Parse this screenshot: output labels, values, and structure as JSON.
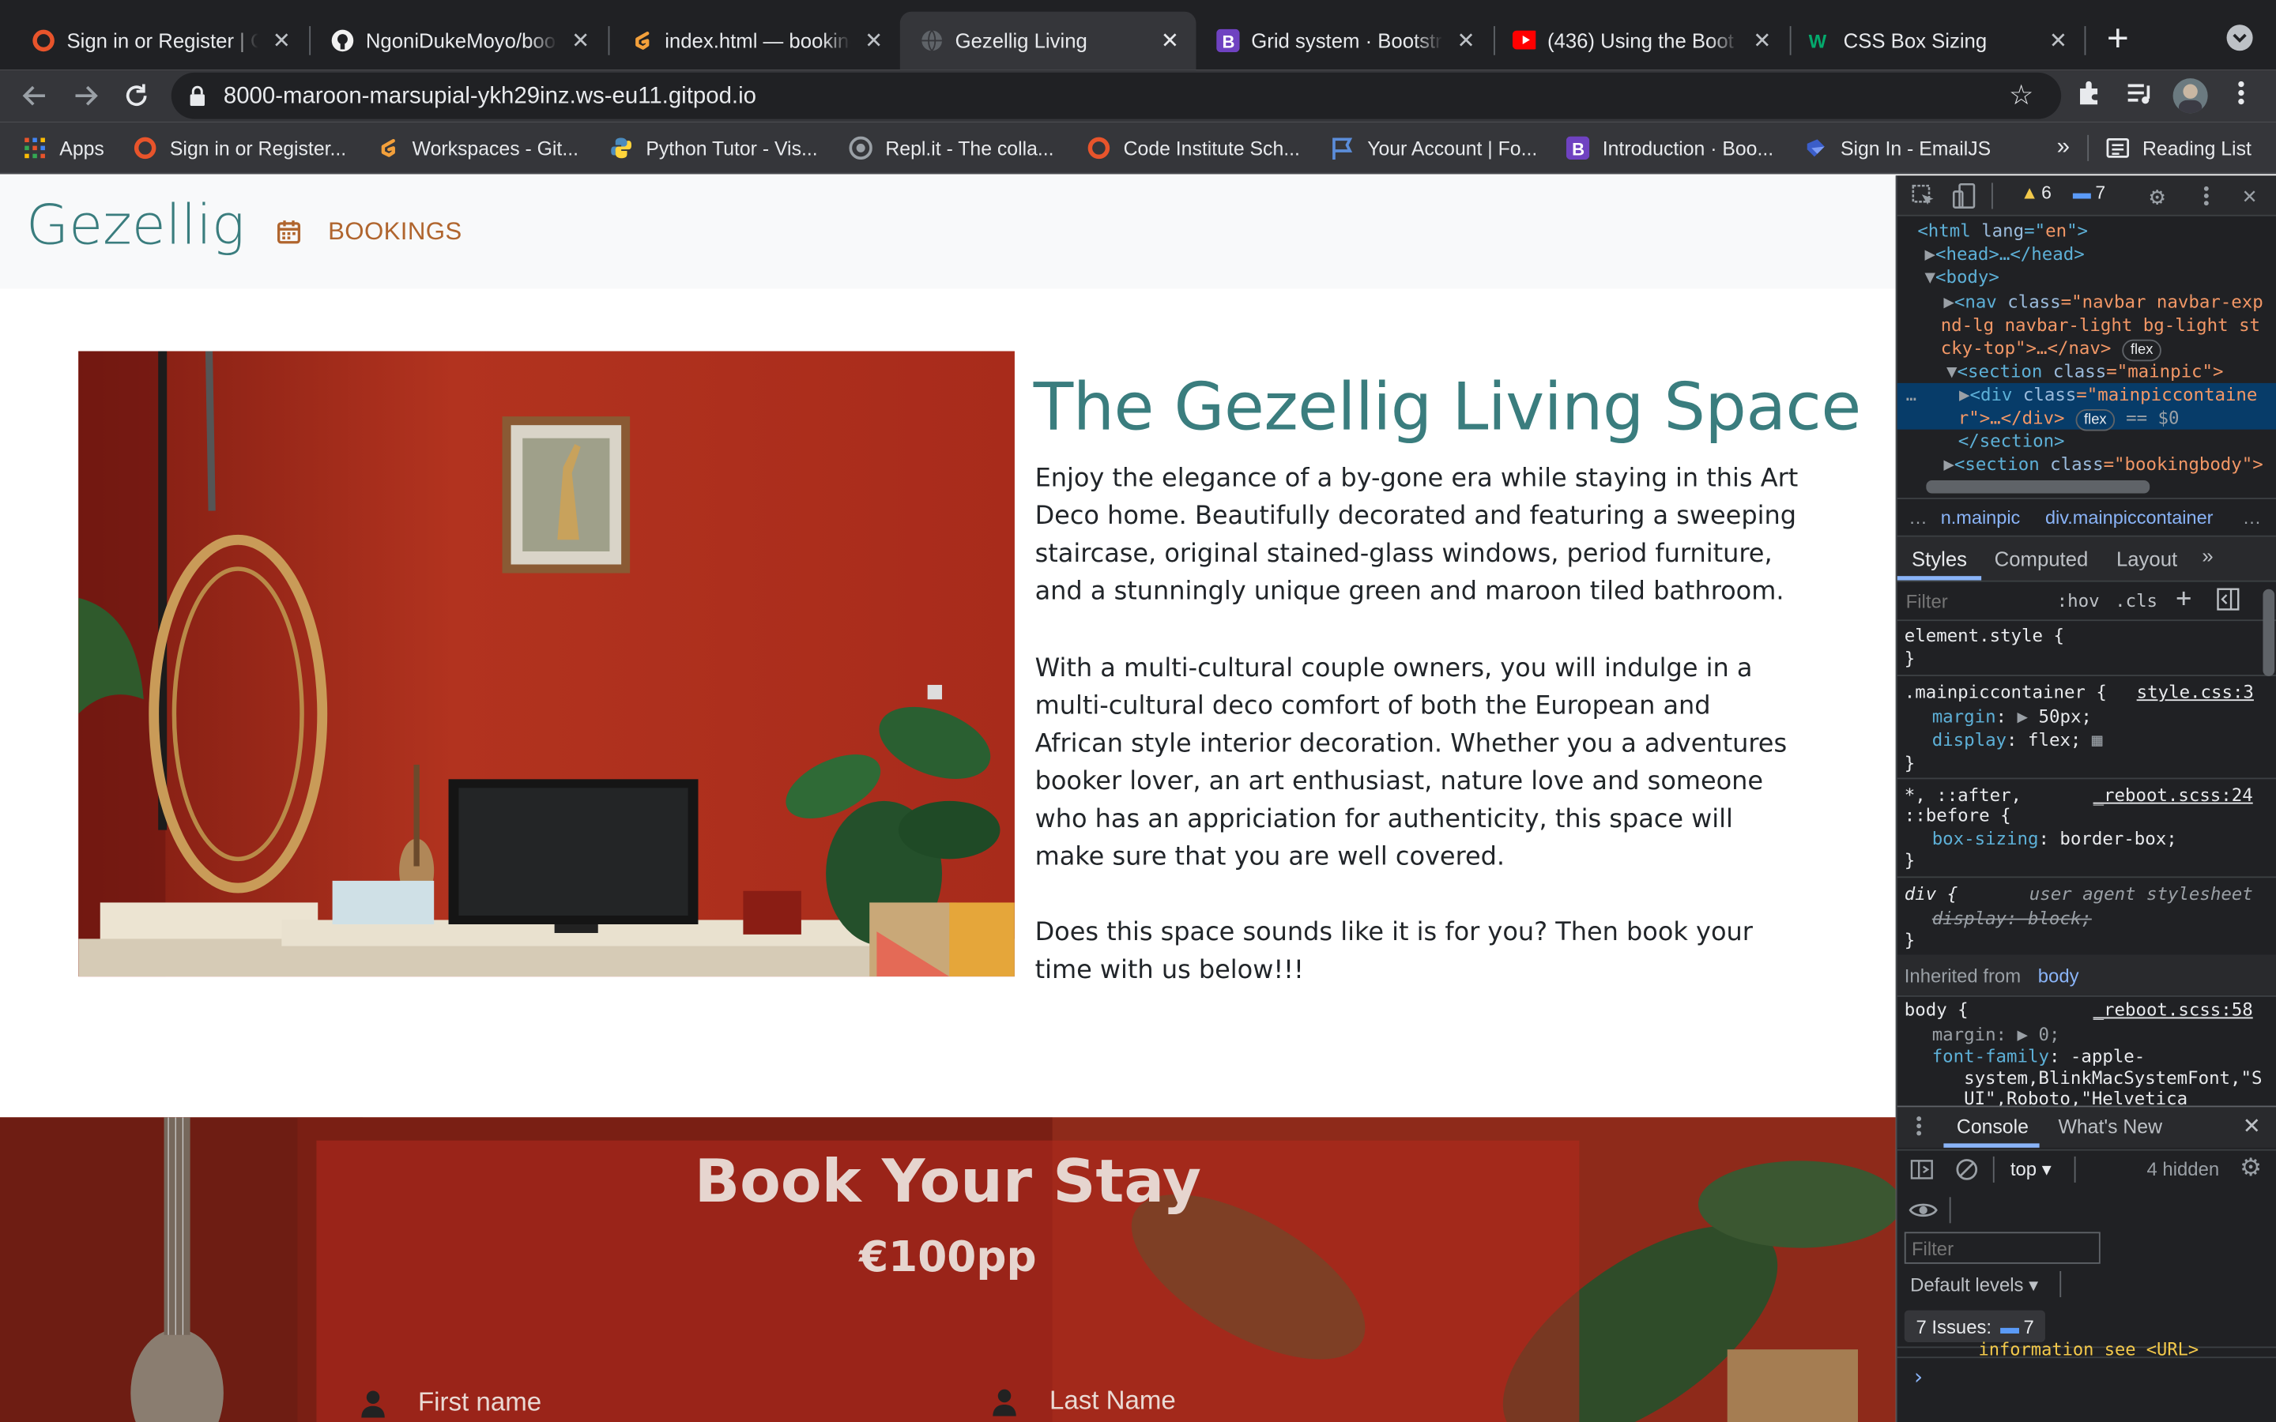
{
  "browser": {
    "tabs": [
      {
        "title": "Sign in or Register | C",
        "icon": "circle-orange-icon",
        "active": false
      },
      {
        "title": "NgoniDukeMoyo/book",
        "icon": "github-icon",
        "active": false
      },
      {
        "title": "index.html — booking",
        "icon": "gitpod-icon",
        "active": false
      },
      {
        "title": "Gezellig Living",
        "icon": "globe-icon",
        "active": true
      },
      {
        "title": "Grid system · Bootstr",
        "icon": "bootstrap-icon",
        "active": false
      },
      {
        "title": "(436) Using the Boot",
        "icon": "youtube-icon",
        "active": false
      },
      {
        "title": "CSS Box Sizing",
        "icon": "w3-icon",
        "active": false
      }
    ],
    "url": "8000-maroon-marsupial-ykh29inz.ws-eu11.gitpod.io",
    "bookmarks": [
      {
        "label": "Apps",
        "icon": "apps-grid-icon"
      },
      {
        "label": "Sign in or Register...",
        "icon": "circle-orange-icon"
      },
      {
        "label": "Workspaces - Git...",
        "icon": "gitpod-icon"
      },
      {
        "label": "Python Tutor - Vis...",
        "icon": "python-icon"
      },
      {
        "label": "Repl.it - The colla...",
        "icon": "replit-icon"
      },
      {
        "label": "Code Institute Sch...",
        "icon": "circle-orange-icon"
      },
      {
        "label": "Your Account | Fo...",
        "icon": "flag-icon"
      },
      {
        "label": "Introduction · Boo...",
        "icon": "bootstrap-icon"
      },
      {
        "label": "Sign In - EmailJS",
        "icon": "emailjs-icon"
      }
    ],
    "more_bookmarks": "»",
    "reading_list": "Reading List"
  },
  "page": {
    "brand": "Gezellig",
    "nav_bookings": "BOOKINGS",
    "heading": "The Gezellig Living Space",
    "paragraphs": [
      "Enjoy the elegance of a by-gone era while staying in this Art Deco home. Beautifully decorated and featuring a sweeping staircase, original stained-glass windows, period furniture, and a stunningly unique green and maroon tiled bathroom.",
      "With a multi-cultural couple owners, you will indulge in a multi-cultural deco comfort of both the European and African style interior decoration. Whether you a adventures booker lover, an art enthusiast, nature love and someone who has an appriciation for authenticity, this space will make sure that you are well covered.",
      "Does this space sounds like it is for you? Then book your time with us below!!!"
    ],
    "booking": {
      "title": "Book Your Stay",
      "price": "€100pp",
      "first_name": "First name",
      "last_name": "Last Name"
    }
  },
  "devtools": {
    "warnings": "6",
    "issues_badge": "7",
    "dom": {
      "l1": [
        "<html ",
        "lang",
        "=\"",
        "en",
        "\">"
      ],
      "l2": "<head>…</head>",
      "l3": "<body>",
      "l4a": "<nav ",
      "l4b": "class",
      "l4c": "=\"navbar navbar-exp",
      "l5": "nd-lg navbar-light bg-light st",
      "l6": "cky-top\">…</nav>",
      "l7a": "<section ",
      "l7b": "class",
      "l7c": "=\"mainpic\">",
      "l8a": "<div ",
      "l8b": "class",
      "l8c": "=\"mainpiccontaine",
      "l9": "r\">…</div>",
      "l9eq": "== $0",
      "l10": "</section>",
      "l11a": "<section ",
      "l11b": "class",
      "l11c": "=\"bookingbody\">",
      "flex": "flex"
    },
    "breadcrumbs": [
      "…",
      "n.mainpic",
      "div.mainpiccontainer",
      "…"
    ],
    "style_tabs": [
      "Styles",
      "Computed",
      "Layout",
      "»"
    ],
    "filter_placeholder": "Filter",
    "hov": ":hov",
    ".cls": ".cls",
    "rules": {
      "element_style": "element.style {",
      "close": "}",
      "mainpic_selector": ".mainpiccontainer {",
      "mainpic_src": "style.css:3",
      "margin_prop": "margin",
      "margin_val": "50px;",
      "display_prop": "display",
      "display_val": "flex;",
      "star_selector": "*, ::after,",
      "star_selector2": "::before {",
      "star_src": "_reboot.scss:24",
      "boxsizing_prop": "box-sizing",
      "boxsizing_val": "border-box;",
      "div_selector": "div {",
      "div_src": "user agent stylesheet",
      "div_prop": "display: block;",
      "inherited": "Inherited from",
      "inherited_el": "body",
      "body_selector": "body {",
      "body_src": "_reboot.scss:58",
      "body_margin": "margin",
      "body_margin_val": "0;",
      "body_font": "font-family",
      "body_font_val1": "-apple-",
      "body_font_val2": "system,BlinkMacSystemFont,\"S",
      "body_font_val3": "UI\",Roboto,\"Helvetica"
    },
    "console_tabs": [
      "Console",
      "What's New"
    ],
    "context": "top",
    "hidden": "4 hidden",
    "console_filter": "Filter",
    "levels": "Default levels",
    "issues_label": "7 Issues:",
    "issues_count": "7",
    "console_line": "information see <URL>",
    "prompt": "›"
  }
}
